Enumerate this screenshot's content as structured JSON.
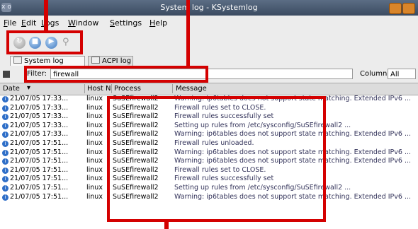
{
  "window": {
    "title": "System log - KSystemlog",
    "sys_icon": "x o"
  },
  "menu": [
    "File",
    "Edit",
    "Logs",
    "Window",
    "Settings",
    "Help"
  ],
  "tabs": [
    {
      "label": "System log",
      "icon": "system-log-icon"
    },
    {
      "label": "ACPI log",
      "icon": "acpi-log-icon"
    }
  ],
  "filter": {
    "label": "Filter:",
    "value": "firewall",
    "column_label": "Column:",
    "column_value": "All"
  },
  "columns": [
    "Date",
    "Host N",
    "Process",
    "Message"
  ],
  "rows": [
    {
      "date": "21/07/05 17:33...",
      "host": "linux",
      "process": "SuSEfirewall2",
      "message": "Warning: ip6tables does not support state matching. Extended IPv6 ..."
    },
    {
      "date": "21/07/05 17:33...",
      "host": "linux",
      "process": "SuSEfirewall2",
      "message": "Firewall rules set to CLOSE."
    },
    {
      "date": "21/07/05 17:33...",
      "host": "linux",
      "process": "SuSEfirewall2",
      "message": "Firewall rules successfully set"
    },
    {
      "date": "21/07/05 17:33...",
      "host": "linux",
      "process": "SuSEfirewall2",
      "message": "Setting up rules from /etc/sysconfig/SuSEfirewall2 ..."
    },
    {
      "date": "21/07/05 17:33...",
      "host": "linux",
      "process": "SuSEfirewall2",
      "message": "Warning: ip6tables does not support state matching. Extended IPv6 ..."
    },
    {
      "date": "21/07/05 17:51...",
      "host": "linux",
      "process": "SuSEfirewall2",
      "message": "Firewall rules unloaded."
    },
    {
      "date": "21/07/05 17:51...",
      "host": "linux",
      "process": "SuSEfirewall2",
      "message": "Warning: ip6tables does not support state matching. Extended IPv6 ..."
    },
    {
      "date": "21/07/05 17:51...",
      "host": "linux",
      "process": "SuSEfirewall2",
      "message": "Warning: ip6tables does not support state matching. Extended IPv6 ..."
    },
    {
      "date": "21/07/05 17:51...",
      "host": "linux",
      "process": "SuSEfirewall2",
      "message": "Firewall rules set to CLOSE."
    },
    {
      "date": "21/07/05 17:51...",
      "host": "linux",
      "process": "SuSEfirewall2",
      "message": "Firewall rules successfully set"
    },
    {
      "date": "21/07/05 17:51...",
      "host": "linux",
      "process": "SuSEfirewall2",
      "message": "Setting up rules from /etc/sysconfig/SuSEfirewall2 ..."
    },
    {
      "date": "21/07/05 17:51...",
      "host": "linux",
      "process": "SuSEfirewall2",
      "message": "Warning: ip6tables does not support state matching. Extended IPv6 ..."
    }
  ],
  "colors": {
    "highlight": "#d40000",
    "titlebar": "#3b4b61"
  }
}
